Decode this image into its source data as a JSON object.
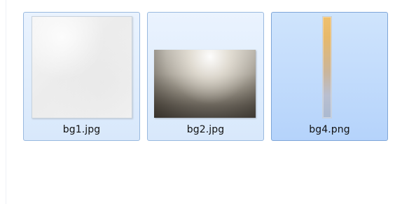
{
  "files": [
    {
      "name": "bg1.jpg"
    },
    {
      "name": "bg2.jpg"
    },
    {
      "name": "bg4.png"
    }
  ],
  "colors": {
    "selection_border": "#7da2ce",
    "selection_fill_top": "#dcebfc",
    "selection_fill_bottom": "#c1dcfb"
  },
  "icons": [
    "image-thumbnail-bg1",
    "image-thumbnail-bg2",
    "image-thumbnail-bg4"
  ]
}
